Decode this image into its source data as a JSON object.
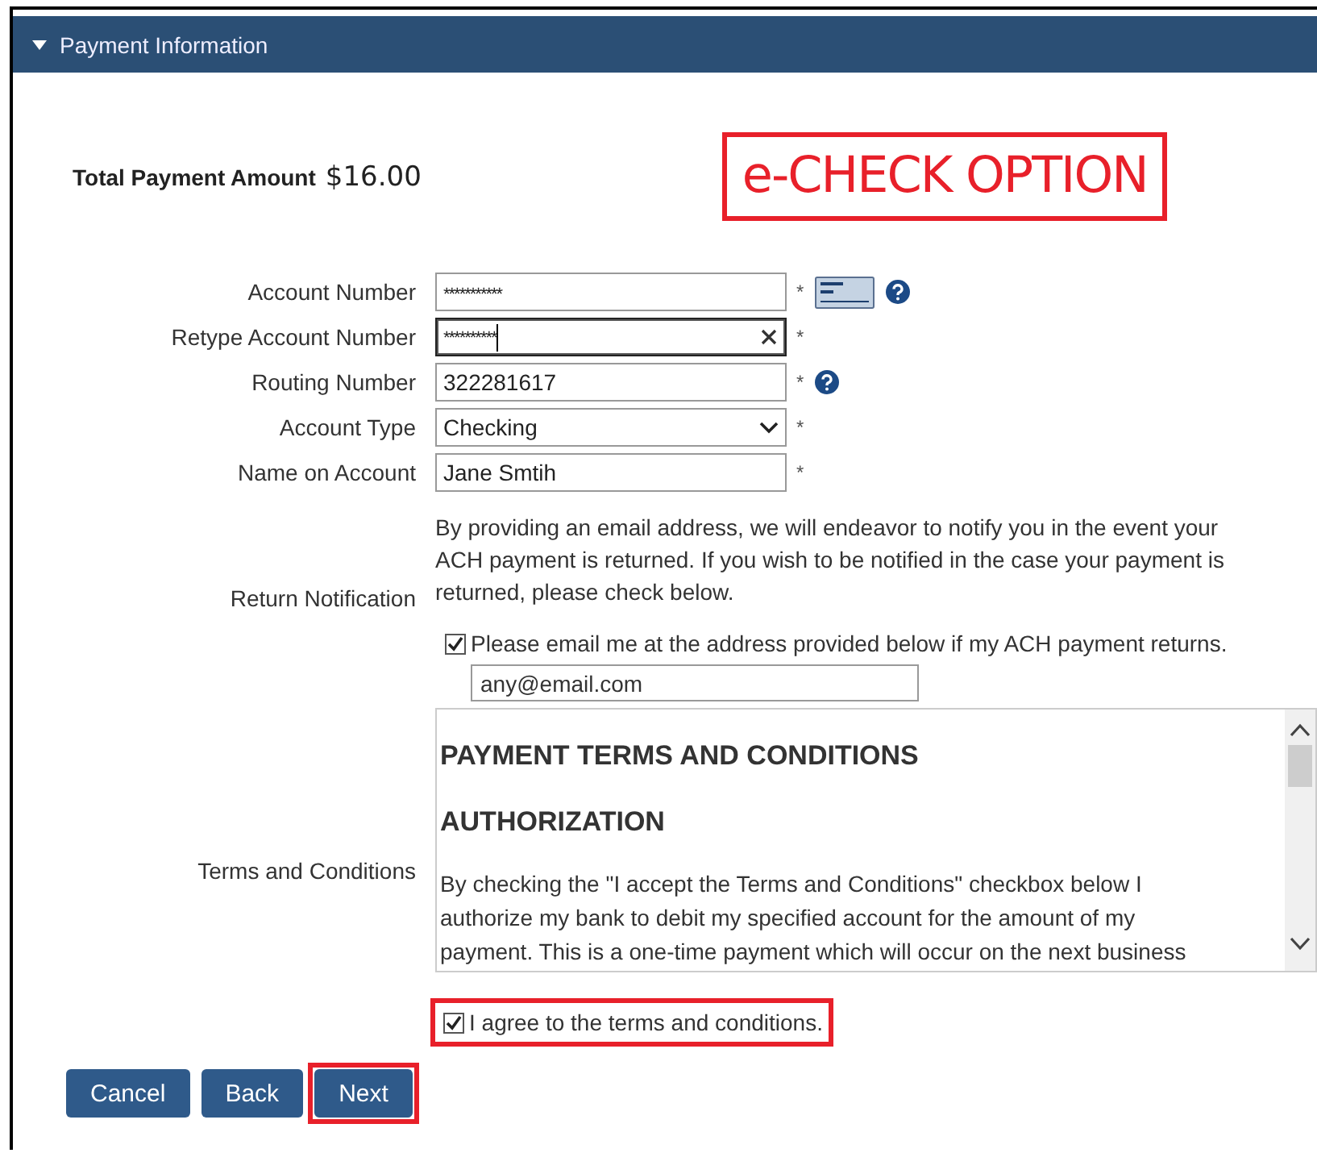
{
  "header": {
    "title": "Payment Information",
    "expanded": true
  },
  "total": {
    "label": "Total Payment Amount",
    "amount": "$16.00"
  },
  "annotation": {
    "text": "e-CHECK OPTION"
  },
  "fields": [
    {
      "kind": "text",
      "label": "Account Number",
      "value": "***********",
      "focused": false,
      "clearable": false,
      "required_mark": "*",
      "check_image": true,
      "help": true
    },
    {
      "kind": "text",
      "label": "Retype Account Number",
      "value": "**********",
      "focused": true,
      "clearable": true,
      "required_mark": "*"
    },
    {
      "kind": "text",
      "label": "Routing Number",
      "value": "322281617",
      "focused": false,
      "clearable": false,
      "required_mark": "*",
      "help": true
    },
    {
      "kind": "select",
      "label": "Account Type",
      "value": "Checking",
      "focused": false,
      "clearable": false,
      "required_mark": "*"
    },
    {
      "kind": "text",
      "label": "Name on Account",
      "value": "Jane Smtih",
      "focused": false,
      "clearable": false,
      "required_mark": "*"
    }
  ],
  "notification": {
    "label": "Return Notification",
    "text": "By providing an email address, we will endeavor to notify you in the event your ACH payment is returned. If you wish to be notified in the case your payment is returned, please check below.",
    "checkbox": {
      "label": "Please email me at the address provided below if my ACH payment returns.",
      "checked": true
    },
    "email": "any@email.com"
  },
  "terms": {
    "label": "Terms and Conditions",
    "headings": [
      "PAYMENT TERMS AND CONDITIONS",
      "AUTHORIZATION"
    ],
    "body": "By checking the \"I accept the Terms and Conditions\" checkbox below I authorize my bank to debit my specified account for the amount of my payment. This is a one-time payment which will occur on the next business"
  },
  "agree": {
    "label": "I agree to the terms and conditions.",
    "checked": true,
    "highlighted": true
  },
  "buttons": [
    {
      "label": "Cancel",
      "highlighted": false
    },
    {
      "label": "Back",
      "highlighted": false
    },
    {
      "label": "Next",
      "highlighted": true
    }
  ]
}
